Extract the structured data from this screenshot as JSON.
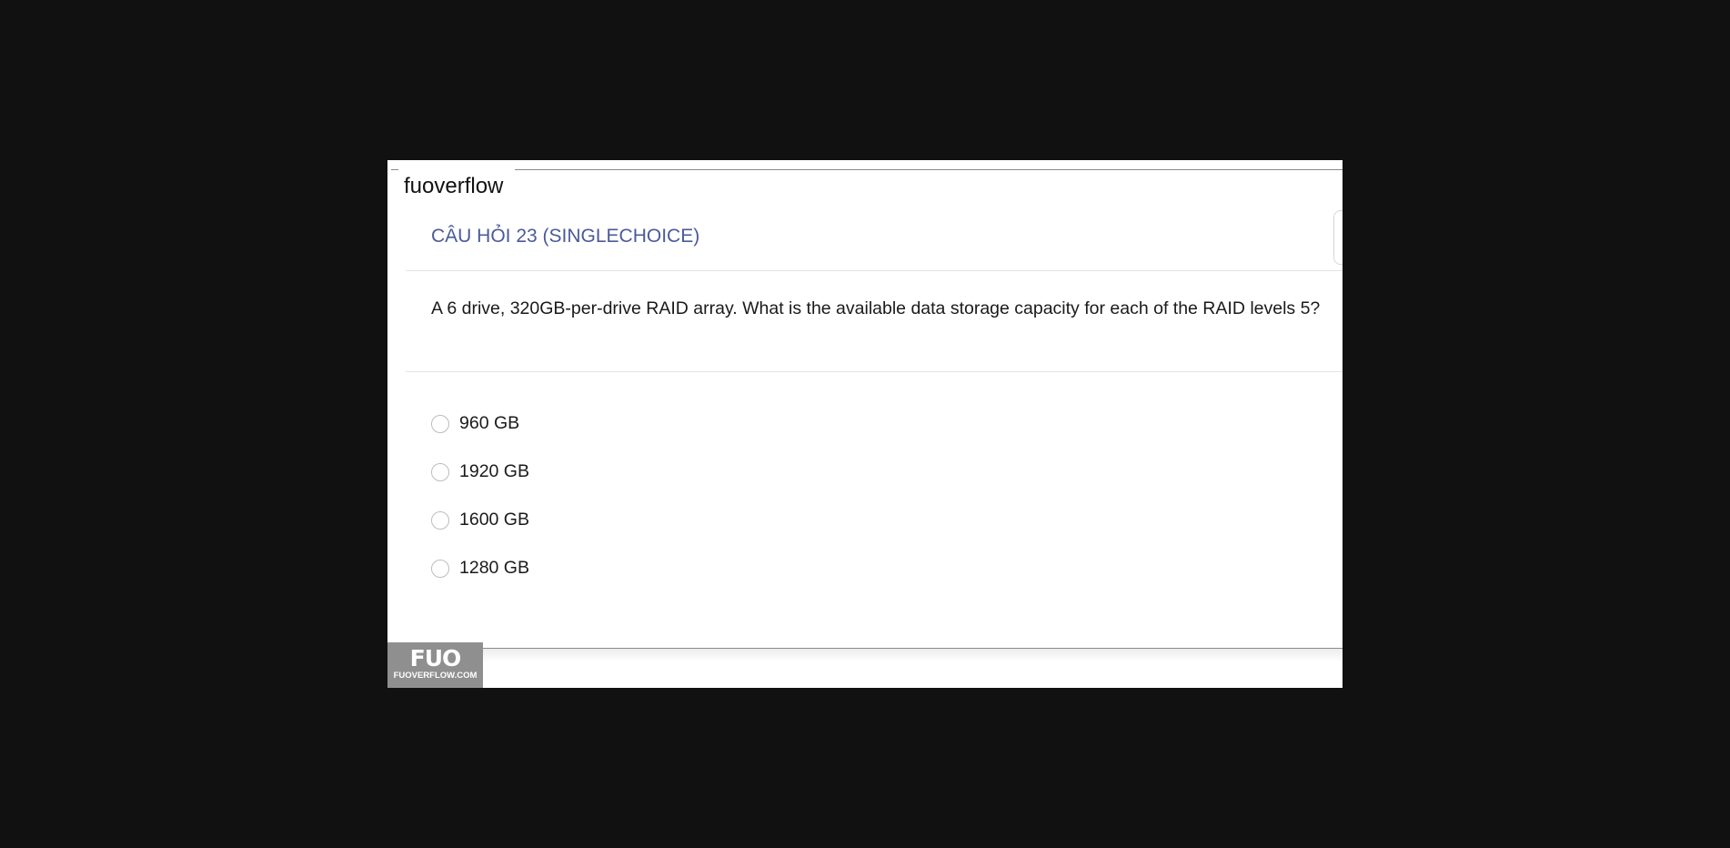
{
  "site": {
    "name": "fuoverflow"
  },
  "question": {
    "header": "CÂU HỎI 23 (SINGLECHOICE)",
    "text": "A 6 drive, 320GB-per-drive RAID array. What is the available data storage capacity for each of the RAID levels 5?",
    "options": [
      {
        "label": "960 GB",
        "selected": false
      },
      {
        "label": "1920 GB",
        "selected": false
      },
      {
        "label": "1600 GB",
        "selected": false
      },
      {
        "label": "1280 GB",
        "selected": false
      }
    ]
  },
  "watermark": {
    "logo_text": "FUO",
    "url_text": "FUOVERFLOW.COM"
  },
  "colors": {
    "background": "#111111",
    "header_accent": "#4b5a9a",
    "watermark_bg": "#8f8f8f"
  }
}
